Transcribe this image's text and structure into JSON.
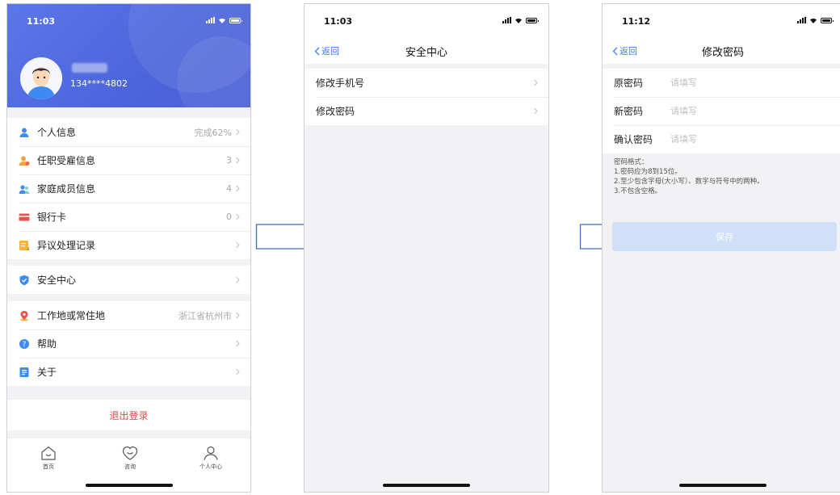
{
  "colors": {
    "accent": "#3a7bf7",
    "header": "#4d66dc",
    "danger": "#e4494b",
    "save_bg": "#cfe0f8"
  },
  "profile_screen": {
    "time": "11:03",
    "user": {
      "phone": "134****4802"
    },
    "menu": [
      {
        "icon": "person-icon",
        "label": "个人信息",
        "value": "完成62%"
      },
      {
        "icon": "employment-icon",
        "label": "任职受雇信息",
        "value": "3"
      },
      {
        "icon": "family-icon",
        "label": "家庭成员信息",
        "value": "4"
      },
      {
        "icon": "bank-card-icon",
        "label": "银行卡",
        "value": "0"
      },
      {
        "icon": "record-icon",
        "label": "异议处理记录",
        "value": ""
      },
      {
        "icon": "shield-icon",
        "label": "安全中心",
        "value": ""
      },
      {
        "icon": "location-icon",
        "label": "工作地或常住地",
        "value": "浙江省杭州市"
      },
      {
        "icon": "help-icon",
        "label": "帮助",
        "value": ""
      },
      {
        "icon": "about-icon",
        "label": "关于",
        "value": ""
      }
    ],
    "logout_label": "退出登录",
    "tabs": [
      {
        "icon": "home-icon",
        "label": "首页"
      },
      {
        "icon": "consult-icon",
        "label": "咨询"
      },
      {
        "icon": "user-center-icon",
        "label": "个人中心"
      }
    ]
  },
  "security_screen": {
    "time": "11:03",
    "back_label": "返回",
    "title": "安全中心",
    "items": [
      {
        "label": "修改手机号"
      },
      {
        "label": "修改密码"
      }
    ]
  },
  "password_screen": {
    "time": "11:12",
    "back_label": "返回",
    "title": "修改密码",
    "fields": [
      {
        "label": "原密码",
        "placeholder": "请填写",
        "value": ""
      },
      {
        "label": "新密码",
        "placeholder": "请填写",
        "value": ""
      },
      {
        "label": "确认密码",
        "placeholder": "请填写",
        "value": ""
      }
    ],
    "rules": [
      "密码格式：",
      "1.密码应为8到15位。",
      "2.至少包含字母(大小写）、数字与符号中的两种。",
      "3.不包含空格。"
    ],
    "save_label": "保存"
  }
}
